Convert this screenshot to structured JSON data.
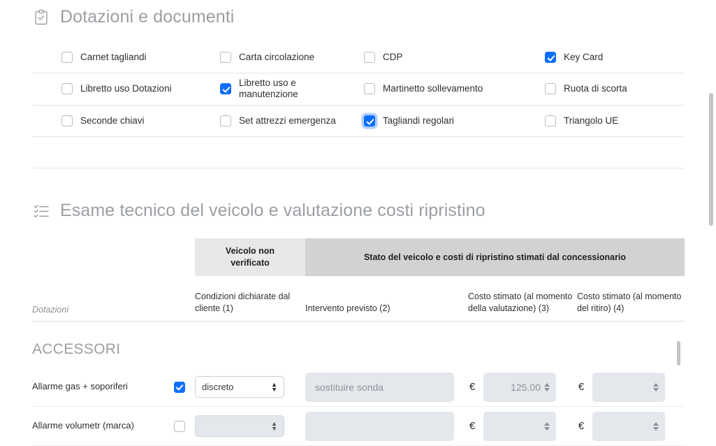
{
  "sections": {
    "dotazioni": {
      "title": "Dotazioni e documenti",
      "icon": "clipboard-check-icon",
      "rows": [
        [
          {
            "label": "Carnet tagliandi",
            "checked": false,
            "focus": false
          },
          {
            "label": "Carta circolazione",
            "checked": false,
            "focus": false
          },
          {
            "label": "CDP",
            "checked": false,
            "focus": false
          },
          {
            "label": "Key Card",
            "checked": true,
            "focus": false
          }
        ],
        [
          {
            "label": "Libretto uso Dotazioni",
            "checked": false,
            "focus": false
          },
          {
            "label": "Libretto uso e manutenzione",
            "checked": true,
            "focus": false
          },
          {
            "label": "Martinetto sollevamento",
            "checked": false,
            "focus": false
          },
          {
            "label": "Ruota di scorta",
            "checked": false,
            "focus": false
          }
        ],
        [
          {
            "label": "Seconde chiavi",
            "checked": false,
            "focus": false
          },
          {
            "label": "Set attrezzi emergenza",
            "checked": false,
            "focus": false
          },
          {
            "label": "Tagliandi regolari",
            "checked": true,
            "focus": true
          },
          {
            "label": "Triangolo UE",
            "checked": false,
            "focus": false
          }
        ]
      ]
    },
    "esame": {
      "title": "Esame tecnico del veicolo e valutazione costi ripristino",
      "icon": "list-check-icon",
      "table": {
        "group_headers": {
          "non_verificato": "Veicolo non verificato",
          "stato_veicolo": "Stato del veicolo e costi di ripristino stimati dal concessionario"
        },
        "columns": {
          "dotazioni": "Dotazioni",
          "condizioni": "Condizioni dichiarate dal cliente (1)",
          "intervento": "Intervento previsto (2)",
          "costo_valutazione": "Costo stimato (al momento della valutazione) (3)",
          "costo_ritiro": "Costo stimato (al momento del ritiro) (4)"
        },
        "group_title": "ACCESSORI",
        "currency_symbol": "€",
        "rows": [
          {
            "name": "Allarme gas + soporiferi",
            "checked": true,
            "condition": "discreto",
            "condition_disabled": false,
            "intervento": "",
            "intervento_placeholder": "sostituire sonda",
            "costo_valutazione": "125.00",
            "costo_ritiro": "",
            "disabled": false
          },
          {
            "name": "Allarme volumetr (marca)",
            "checked": false,
            "condition": "",
            "condition_disabled": true,
            "intervento": "",
            "intervento_placeholder": "",
            "costo_valutazione": "",
            "costo_ritiro": "",
            "disabled": true
          }
        ]
      }
    }
  },
  "colors": {
    "accent": "#0d6efd",
    "header_text": "#9b9fa3",
    "header_cell_light": "#e8e8e8",
    "header_cell_dark": "#d2d2d2",
    "field_bg": "#e4e8ec"
  }
}
